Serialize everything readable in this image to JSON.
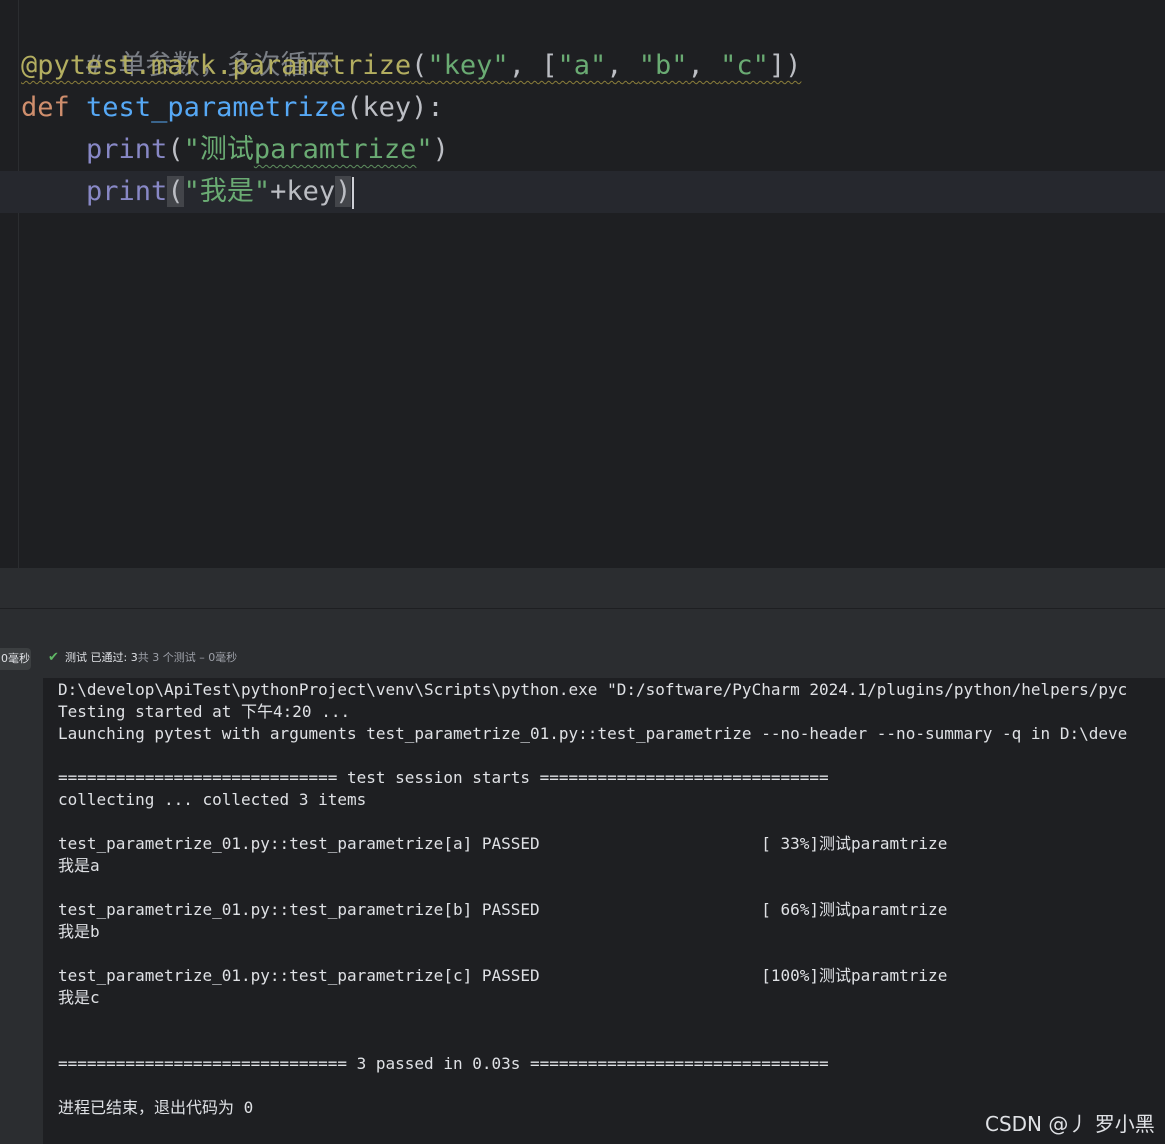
{
  "editor": {
    "line1_comment": "# 单参数，多次循环",
    "line2": {
      "decorator": "@pytest.mark.parametrize",
      "open": "(",
      "arg1": "\"key\"",
      "sep1": ", [",
      "v1": "\"a\"",
      "sep2": ", ",
      "v2": "\"b\"",
      "sep3": ", ",
      "v3": "\"c\"",
      "close": "])"
    },
    "line3": {
      "kw": "def",
      "fn": "test_parametrize",
      "rest": "(key):"
    },
    "line4": {
      "builtin": "print",
      "open": "(",
      "str_a": "\"测试",
      "str_b": "paramtrize",
      "str_c": "\"",
      "close": ")"
    },
    "line5": {
      "builtin": "print",
      "open": "(",
      "str": "\"我是\"",
      "rest": "+key",
      "close": ")"
    }
  },
  "run_panel": {
    "time_badge": "0毫秒",
    "status_label": "测试",
    "status_passed": "已通过: 3",
    "status_total": "共 3 个测试 – 0毫秒",
    "console_lines": [
      "D:\\develop\\ApiTest\\pythonProject\\venv\\Scripts\\python.exe \"D:/software/PyCharm 2024.1/plugins/python/helpers/pyc",
      "Testing started at 下午4:20 ...",
      "Launching pytest with arguments test_parametrize_01.py::test_parametrize --no-header --no-summary -q in D:\\deve",
      "",
      "============================= test session starts ==============================",
      "collecting ... collected 3 items",
      "",
      "test_parametrize_01.py::test_parametrize[a] PASSED                       [ 33%]测试paramtrize",
      "我是a",
      "",
      "test_parametrize_01.py::test_parametrize[b] PASSED                       [ 66%]测试paramtrize",
      "我是b",
      "",
      "test_parametrize_01.py::test_parametrize[c] PASSED                       [100%]测试paramtrize",
      "我是c",
      "",
      "",
      "============================== 3 passed in 0.03s ===============================",
      "",
      "进程已结束，退出代码为 0"
    ]
  },
  "watermark": "CSDN @丿 罗小黑"
}
